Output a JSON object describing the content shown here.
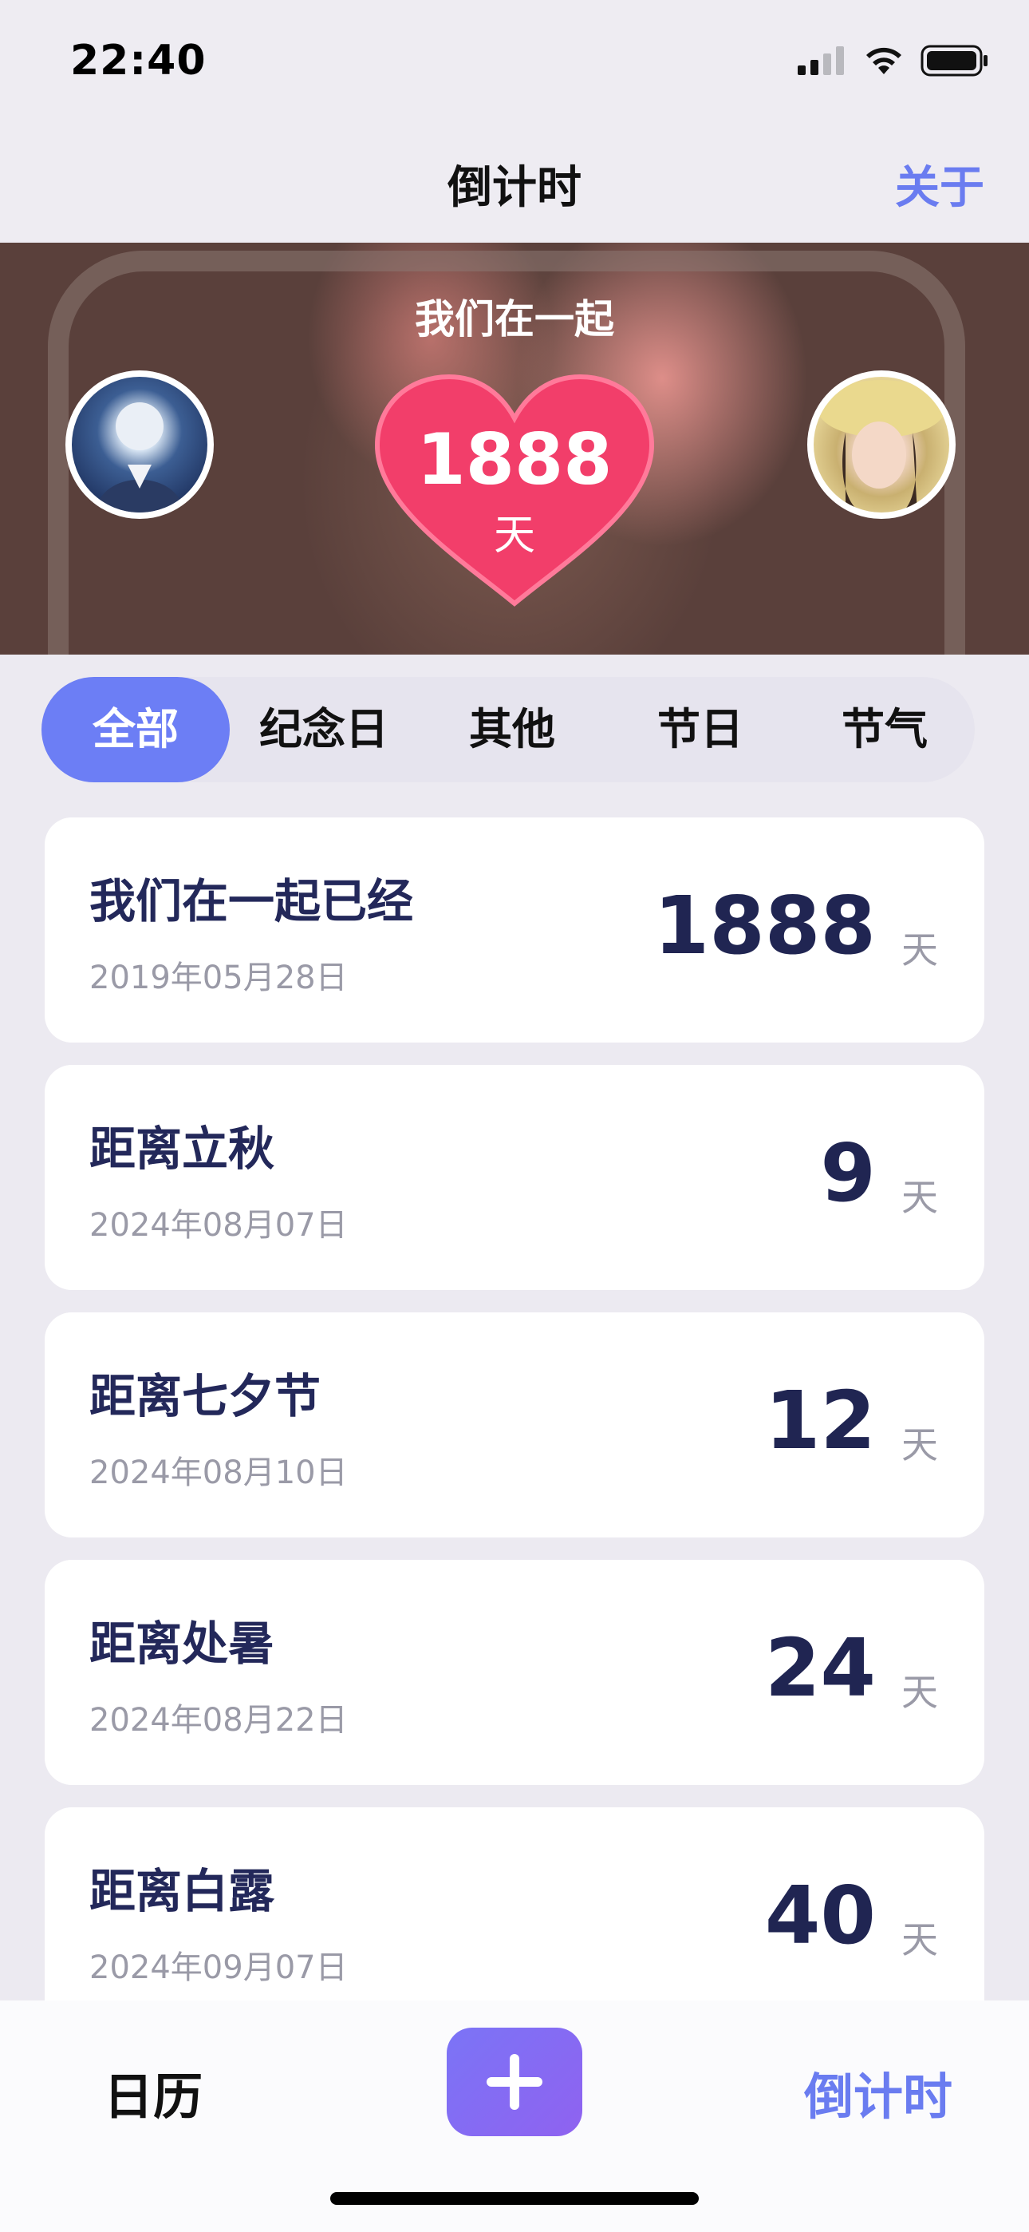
{
  "status_bar": {
    "time": "22:40"
  },
  "nav": {
    "title": "倒计时",
    "about": "关于"
  },
  "banner": {
    "title": "我们在一起",
    "days": "1888",
    "unit": "天"
  },
  "tabs": [
    {
      "label": "全部",
      "active": true
    },
    {
      "label": "纪念日",
      "active": false
    },
    {
      "label": "其他",
      "active": false
    },
    {
      "label": "节日",
      "active": false
    },
    {
      "label": "节气",
      "active": false
    }
  ],
  "events": [
    {
      "title": "我们在一起已经",
      "date": "2019年05月28日",
      "days": "1888",
      "unit": "天"
    },
    {
      "title": "距离立秋",
      "date": "2024年08月07日",
      "days": "9",
      "unit": "天"
    },
    {
      "title": "距离七夕节",
      "date": "2024年08月10日",
      "days": "12",
      "unit": "天"
    },
    {
      "title": "距离处暑",
      "date": "2024年08月22日",
      "days": "24",
      "unit": "天"
    },
    {
      "title": "距离白露",
      "date": "2024年09月07日",
      "days": "40",
      "unit": "天"
    }
  ],
  "bottom_bar": {
    "calendar": "日历",
    "countdown": "倒计时"
  },
  "colors": {
    "accent": "#6a7cf0",
    "heart": "#f23e6a",
    "number": "#202552"
  },
  "icons": [
    "cellular-signal-icon",
    "wifi-icon",
    "battery-icon",
    "heart-icon",
    "plus-icon"
  ]
}
